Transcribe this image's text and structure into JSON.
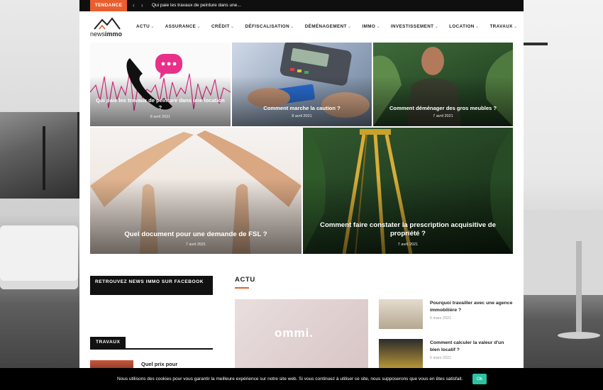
{
  "topbar": {
    "trending_label": "TENDANCE",
    "trending_text": "Qui paie les travaux de peinture dans une..."
  },
  "logo": {
    "brand_light": "news",
    "brand_bold": "immo"
  },
  "nav": {
    "items": [
      {
        "label": "ACTU"
      },
      {
        "label": "ASSURANCE"
      },
      {
        "label": "CRÉDIT"
      },
      {
        "label": "DÉFISCALISATION"
      },
      {
        "label": "DÉMÉNAGEMENT"
      },
      {
        "label": "IMMO"
      },
      {
        "label": "INVESTISSEMENT"
      },
      {
        "label": "LOCATION"
      },
      {
        "label": "TRAVAUX"
      }
    ]
  },
  "featured": [
    {
      "title": "Qui paie les travaux de peinture dans une location ?",
      "date": "8 avril 2021"
    },
    {
      "title": "Comment marche la caution ?",
      "date": "8 avril 2021"
    },
    {
      "title": "Comment déménager des gros meubles ?",
      "date": "7 avril 2021"
    },
    {
      "title": "Quel document pour une demande de FSL ?",
      "date": "7 avril 2021"
    },
    {
      "title": "Comment faire constater la prescription acquisitive de propriété ?",
      "date": "7 avril 2021"
    }
  ],
  "sidebar": {
    "facebook_title": "RETROUVEZ NEWS IMMO SUR FACEBOOK",
    "travaux_label": "TRAVAUX",
    "travaux_post_title": "Quel prix pour"
  },
  "actu": {
    "heading": "ACTU",
    "big_logo": "ommi.",
    "side_posts": [
      {
        "title": "Pourquoi travailler avec une agence immobilière ?",
        "date": "6 mars 2021"
      },
      {
        "title": "Comment calculer la valeur d'un bien locatif ?",
        "date": "6 mars 2021"
      }
    ]
  },
  "cookie": {
    "text": "Nous utilisons des cookies pour vous garantir la meilleure expérience sur notre site web. Si vous continuez à utiliser ce site, nous supposerons que vous en êtes satisfait.",
    "ok_label": "Ok"
  },
  "colors": {
    "accent": "#e95e2f",
    "cookie_button": "#2ec2a2",
    "phone_bubble": "#e8308a"
  },
  "icons": {
    "nav_chevron": "chevron-down-icon",
    "prev": "chevron-left-icon",
    "next": "chevron-right-icon"
  }
}
